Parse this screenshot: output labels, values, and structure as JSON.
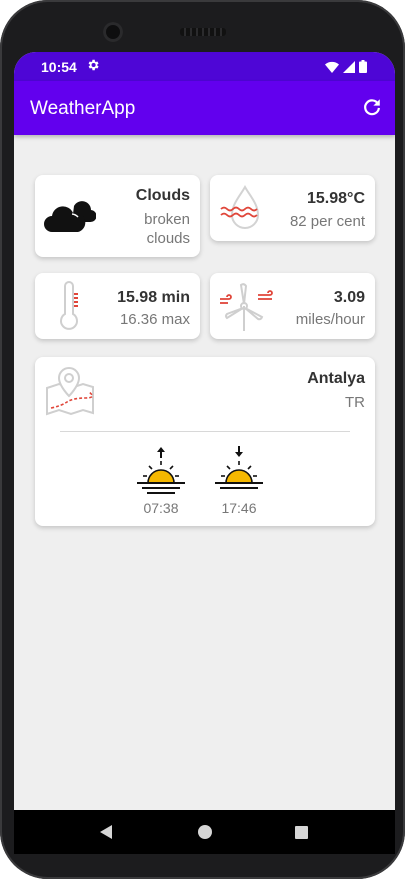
{
  "status_bar": {
    "time": "10:54"
  },
  "app_bar": {
    "title": "WeatherApp"
  },
  "cards": {
    "condition": {
      "main": "Clouds",
      "description": "broken clouds"
    },
    "humidity": {
      "temp": "15.98°C",
      "humidity": "82 per cent"
    },
    "temperature": {
      "min": "15.98 min",
      "max": "16.36 max"
    },
    "wind": {
      "speed": "3.09",
      "unit": "miles/hour"
    },
    "location": {
      "city": "Antalya",
      "country": "TR",
      "sunrise": "07:38",
      "sunset": "17:46"
    }
  },
  "colors": {
    "status_bar": "#4e06d6",
    "app_bar": "#6200ee",
    "background": "#efefef",
    "sun": "#f5b800",
    "accent_red": "#e0463a"
  }
}
